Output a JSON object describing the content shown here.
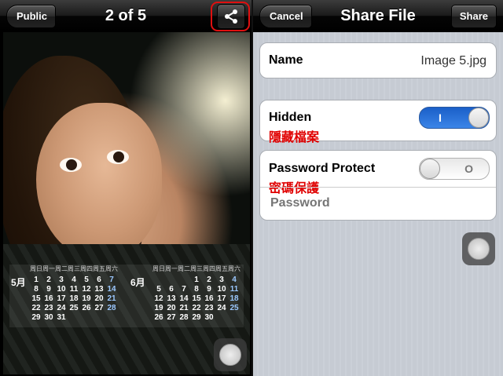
{
  "left": {
    "navbar": {
      "back_label": "Public",
      "title": "2 of 5",
      "share_icon": "share-icon"
    },
    "calendar": {
      "headers": [
        "周日",
        "周一",
        "周二",
        "周三",
        "周四",
        "周五",
        "周六"
      ],
      "may": {
        "month": "5月",
        "rows": [
          [
            "",
            "",
            "1",
            "2",
            "3",
            "4",
            "5",
            "6",
            "7"
          ],
          [
            "8",
            "9",
            "10",
            "11",
            "12",
            "13",
            "14"
          ],
          [
            "15",
            "16",
            "17",
            "18",
            "19",
            "20",
            "21"
          ],
          [
            "22",
            "23",
            "24",
            "25",
            "26",
            "27",
            "28"
          ],
          [
            "29",
            "30",
            "31",
            "",
            "",
            "",
            ""
          ]
        ]
      },
      "june": {
        "month": "6月",
        "rows": [
          [
            "",
            "",
            "",
            "1",
            "2",
            "3",
            "4"
          ],
          [
            "5",
            "6",
            "7",
            "8",
            "9",
            "10",
            "11"
          ],
          [
            "12",
            "13",
            "14",
            "15",
            "16",
            "17",
            "18"
          ],
          [
            "19",
            "20",
            "21",
            "22",
            "23",
            "24",
            "25"
          ],
          [
            "26",
            "27",
            "28",
            "29",
            "30",
            "",
            ""
          ]
        ]
      }
    }
  },
  "right": {
    "navbar": {
      "cancel_label": "Cancel",
      "title": "Share File",
      "share_label": "Share"
    },
    "name": {
      "label": "Name",
      "value": "Image 5.jpg"
    },
    "hidden": {
      "label": "Hidden",
      "annotation": "隱藏檔案",
      "state": "on",
      "glyph": "I"
    },
    "password_protect": {
      "label": "Password Protect",
      "annotation": "密碼保護",
      "state": "off",
      "glyph": "O"
    },
    "password": {
      "placeholder": "Password"
    }
  },
  "colors": {
    "annotation_red": "#e00000",
    "toggle_on_blue": "#2f74d8",
    "highlight_red": "#e01010"
  }
}
